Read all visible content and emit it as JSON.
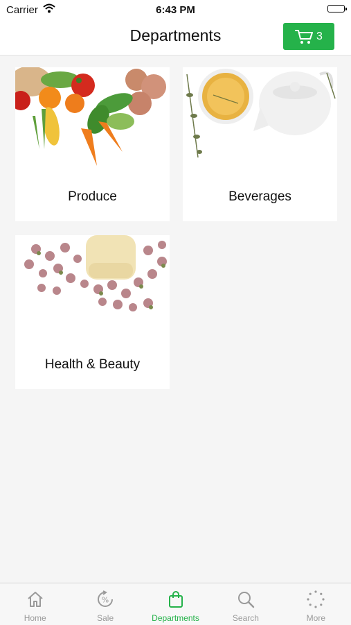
{
  "status": {
    "carrier": "Carrier",
    "time": "6:43 PM"
  },
  "header": {
    "title": "Departments",
    "cart_count": "3"
  },
  "departments": [
    {
      "name": "Produce"
    },
    {
      "name": "Beverages"
    },
    {
      "name": "Health & Beauty"
    }
  ],
  "tabs": [
    {
      "label": "Home",
      "icon": "home-icon"
    },
    {
      "label": "Sale",
      "icon": "sale-icon"
    },
    {
      "label": "Departments",
      "icon": "shopping-bag-icon",
      "active": true
    },
    {
      "label": "Search",
      "icon": "search-icon"
    },
    {
      "label": "More",
      "icon": "more-icon"
    }
  ],
  "colors": {
    "accent": "#25b24a",
    "tab_inactive": "#9a9a9a",
    "background": "#f5f5f5"
  }
}
